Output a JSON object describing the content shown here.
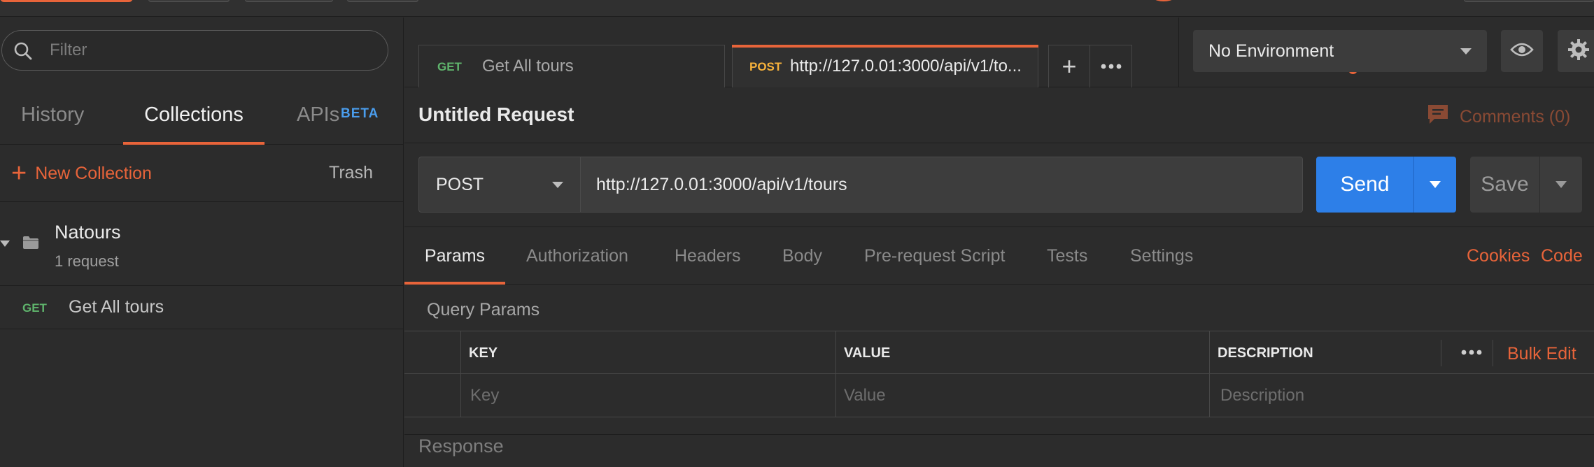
{
  "sidebar": {
    "filter_placeholder": "Filter",
    "tabs": [
      {
        "label": "History"
      },
      {
        "label": "Collections"
      },
      {
        "label": "APIs"
      }
    ],
    "apis_badge": "BETA",
    "new_collection_label": "New Collection",
    "trash_label": "Trash",
    "collection": {
      "name": "Natours",
      "count": "1 request"
    },
    "request_item": {
      "method": "GET",
      "name": "Get All tours"
    }
  },
  "tabs": [
    {
      "method": "GET",
      "title": "Get All tours"
    },
    {
      "method": "POST",
      "title": "http://127.0.01:3000/api/v1/to..."
    }
  ],
  "environment": {
    "selected": "No Environment"
  },
  "request": {
    "title": "Untitled Request",
    "comments_label": "Comments (0)",
    "method": "POST",
    "url": "http://127.0.01:3000/api/v1/tours",
    "send_label": "Send",
    "save_label": "Save"
  },
  "request_tabs": [
    {
      "label": "Params"
    },
    {
      "label": "Authorization"
    },
    {
      "label": "Headers"
    },
    {
      "label": "Body"
    },
    {
      "label": "Pre-request Script"
    },
    {
      "label": "Tests"
    },
    {
      "label": "Settings"
    }
  ],
  "links": {
    "cookies": "Cookies",
    "code": "Code"
  },
  "params": {
    "title": "Query Params",
    "headers": {
      "key": "KEY",
      "value": "VALUE",
      "description": "DESCRIPTION"
    },
    "placeholders": {
      "key": "Key",
      "value": "Value",
      "description": "Description"
    },
    "bulk_edit_label": "Bulk Edit"
  },
  "response": {
    "title": "Response"
  },
  "colors": {
    "accent": "#e8643a",
    "send": "#2d7fe8",
    "get_method": "#5fb46c",
    "post_method": "#f7b23b",
    "beta_badge": "#4a9ded"
  },
  "icons": [
    "search-icon",
    "plus-icon",
    "caret-down-icon",
    "folder-icon",
    "eye-icon",
    "gear-icon",
    "comment-icon",
    "more-icon"
  ]
}
